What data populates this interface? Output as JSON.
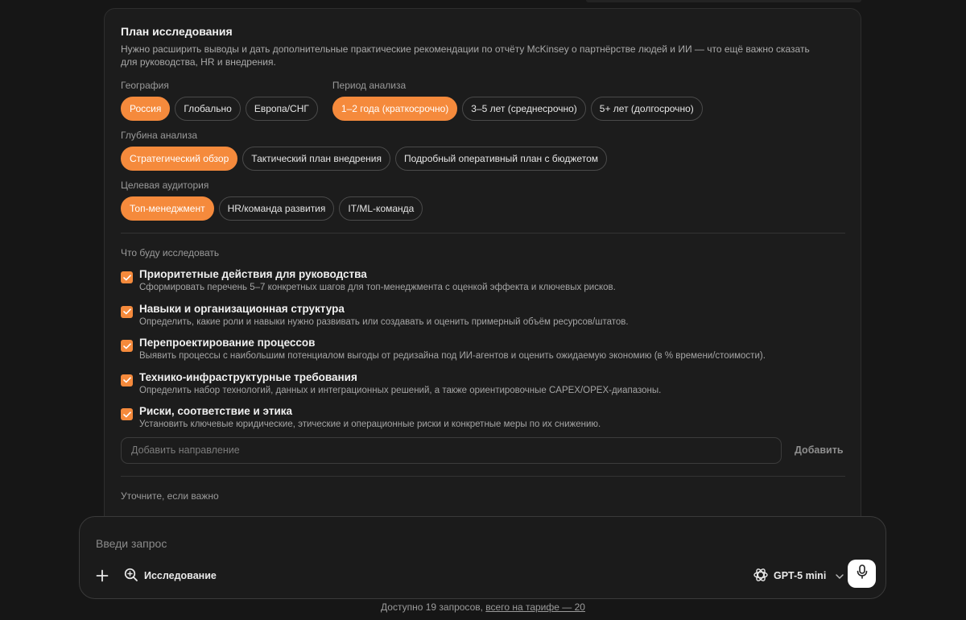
{
  "plan": {
    "title": "План исследования",
    "subtitle": "Нужно расширить выводы и дать дополнительные практические рекомендации по отчёту McKinsey о партнёрстве людей и ИИ — что ещё важно сказать для руководства, HR и внедрения."
  },
  "geography": {
    "label": "География",
    "options": [
      "Россия",
      "Глобально",
      "Европа/СНГ"
    ],
    "selected": "Россия"
  },
  "period": {
    "label": "Период анализа",
    "options": [
      "1–2 года (краткосрочно)",
      "3–5 лет (среднесрочно)",
      "5+ лет (долгосрочно)"
    ],
    "selected": "1–2 года (краткосрочно)"
  },
  "depth": {
    "label": "Глубина анализа",
    "options": [
      "Стратегический обзор",
      "Тактический план внедрения",
      "Подробный оперативный план с бюджетом"
    ],
    "selected": "Стратегический обзор"
  },
  "audience": {
    "label": "Целевая аудитория",
    "options": [
      "Топ-менеджмент",
      "HR/команда развития",
      "IT/ML-команда"
    ],
    "selected": "Топ-менеджмент"
  },
  "research": {
    "label": "Что буду исследовать",
    "items": [
      {
        "title": "Приоритетные действия для руководства",
        "desc": "Сформировать перечень 5–7 конкретных шагов для топ-менеджмента с оценкой эффекта и ключевых рисков.",
        "checked": true
      },
      {
        "title": "Навыки и организационная структура",
        "desc": "Определить, какие роли и навыки нужно развивать или создавать и оценить примерный объём ресурсов/штатов.",
        "checked": true
      },
      {
        "title": "Перепроектирование процессов",
        "desc": "Выявить процессы с наибольшим потенциалом выгоды от редизайна под ИИ-агентов и оценить ожидаемую экономию (в % времени/стоимости).",
        "checked": true
      },
      {
        "title": "Технико-инфраструктурные требования",
        "desc": "Определить набор технологий, данных и интеграционных решений, а также ориентировочные CAPEX/OPEX-диапазоны.",
        "checked": true
      },
      {
        "title": "Риски, соответствие и этика",
        "desc": "Установить ключевые юридические, этические и операционные риски и конкретные меры по их снижению.",
        "checked": true
      }
    ],
    "add_placeholder": "Добавить направление",
    "add_button": "Добавить"
  },
  "clarify": {
    "label": "Уточните, если важно"
  },
  "composer": {
    "placeholder": "Введи запрос",
    "research_label": "Исследование",
    "model": "GPT-5 mini"
  },
  "footer": {
    "text": "Доступно 19 запросов,",
    "link": "всего на тарифе — 20"
  },
  "colors": {
    "accent": "#f58a3c",
    "background": "#161616",
    "panel": "#1c1c1c"
  }
}
